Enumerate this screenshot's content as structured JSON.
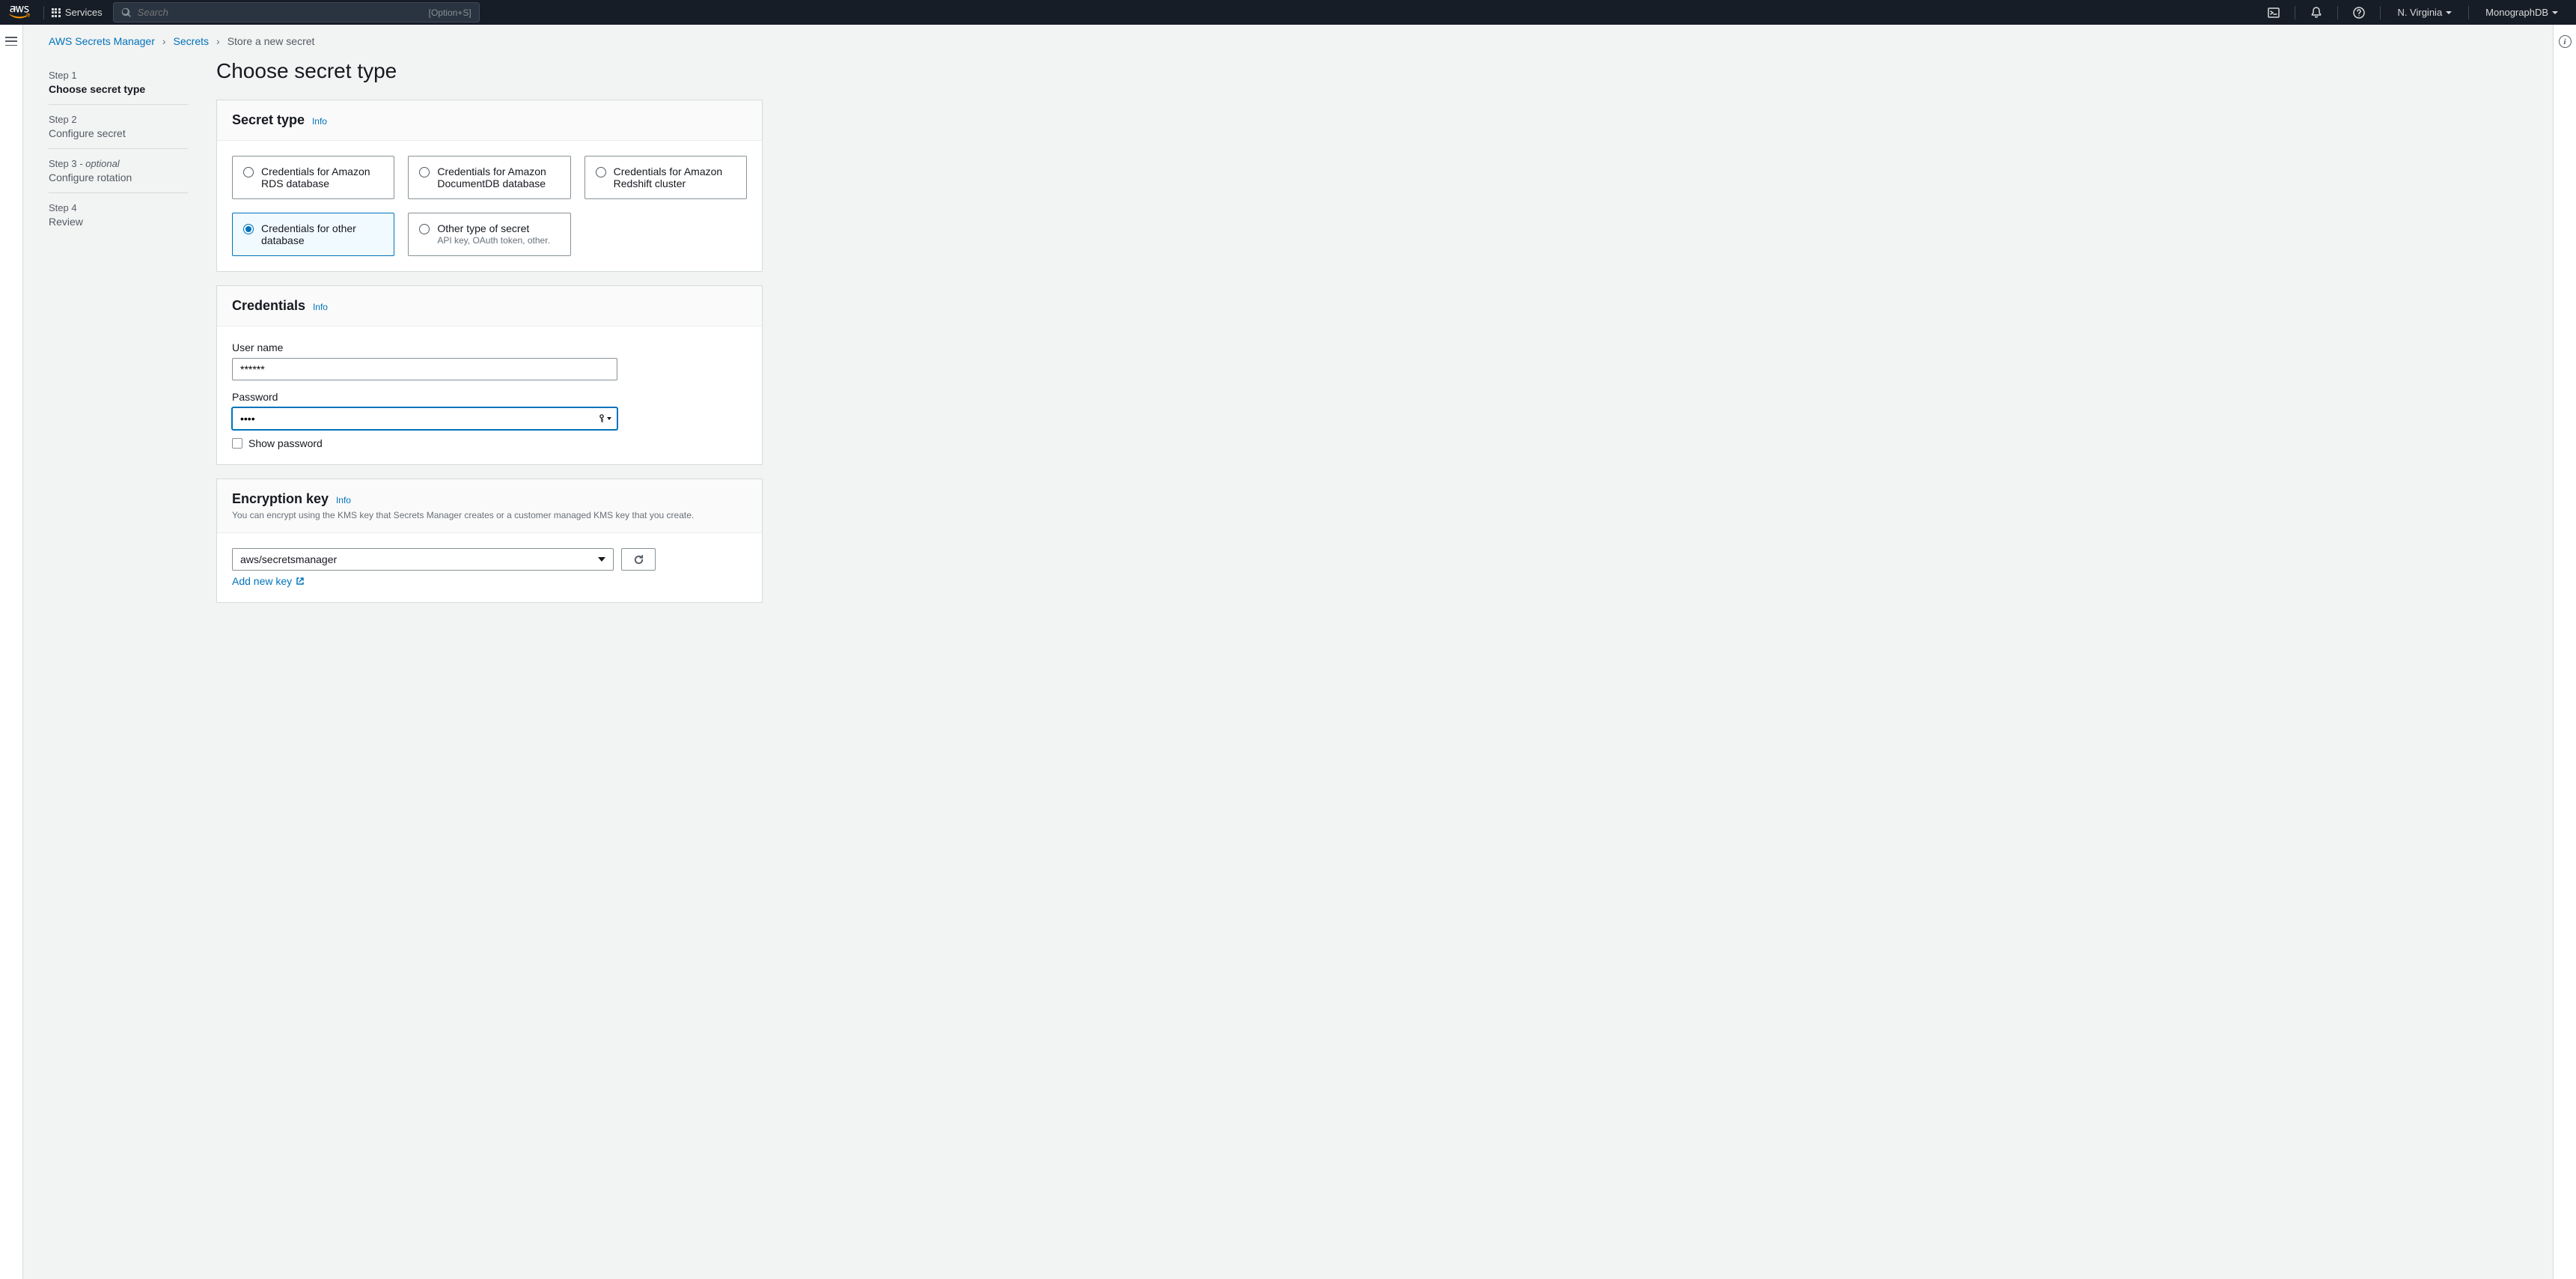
{
  "topnav": {
    "services_label": "Services",
    "search_placeholder": "Search",
    "search_shortcut": "[Option+S]",
    "region": "N. Virginia",
    "account": "MonographDB"
  },
  "breadcrumb": {
    "service": "AWS Secrets Manager",
    "secrets": "Secrets",
    "current": "Store a new secret"
  },
  "steps": [
    {
      "num": "Step 1",
      "name": "Choose secret type",
      "active": true
    },
    {
      "num": "Step 2",
      "name": "Configure secret",
      "active": false
    },
    {
      "num": "Step 3",
      "optional": " - optional",
      "name": "Configure rotation",
      "active": false
    },
    {
      "num": "Step 4",
      "name": "Review",
      "active": false
    }
  ],
  "page_title": "Choose secret type",
  "secret_type": {
    "heading": "Secret type",
    "info": "Info",
    "tiles": [
      {
        "label": "Credentials for Amazon RDS database",
        "sub": "",
        "selected": false
      },
      {
        "label": "Credentials for Amazon DocumentDB database",
        "sub": "",
        "selected": false
      },
      {
        "label": "Credentials for Amazon Redshift cluster",
        "sub": "",
        "selected": false
      },
      {
        "label": "Credentials for other database",
        "sub": "",
        "selected": true
      },
      {
        "label": "Other type of secret",
        "sub": "API key, OAuth token, other.",
        "selected": false
      }
    ]
  },
  "credentials": {
    "heading": "Credentials",
    "info": "Info",
    "username_label": "User name",
    "username_value": "******",
    "password_label": "Password",
    "password_value": "••••",
    "show_password_label": "Show password"
  },
  "encryption": {
    "heading": "Encryption key",
    "info": "Info",
    "subtitle": "You can encrypt using the KMS key that Secrets Manager creates or a customer managed KMS key that you create.",
    "selected_key": "aws/secretsmanager",
    "add_key_label": "Add new key"
  }
}
